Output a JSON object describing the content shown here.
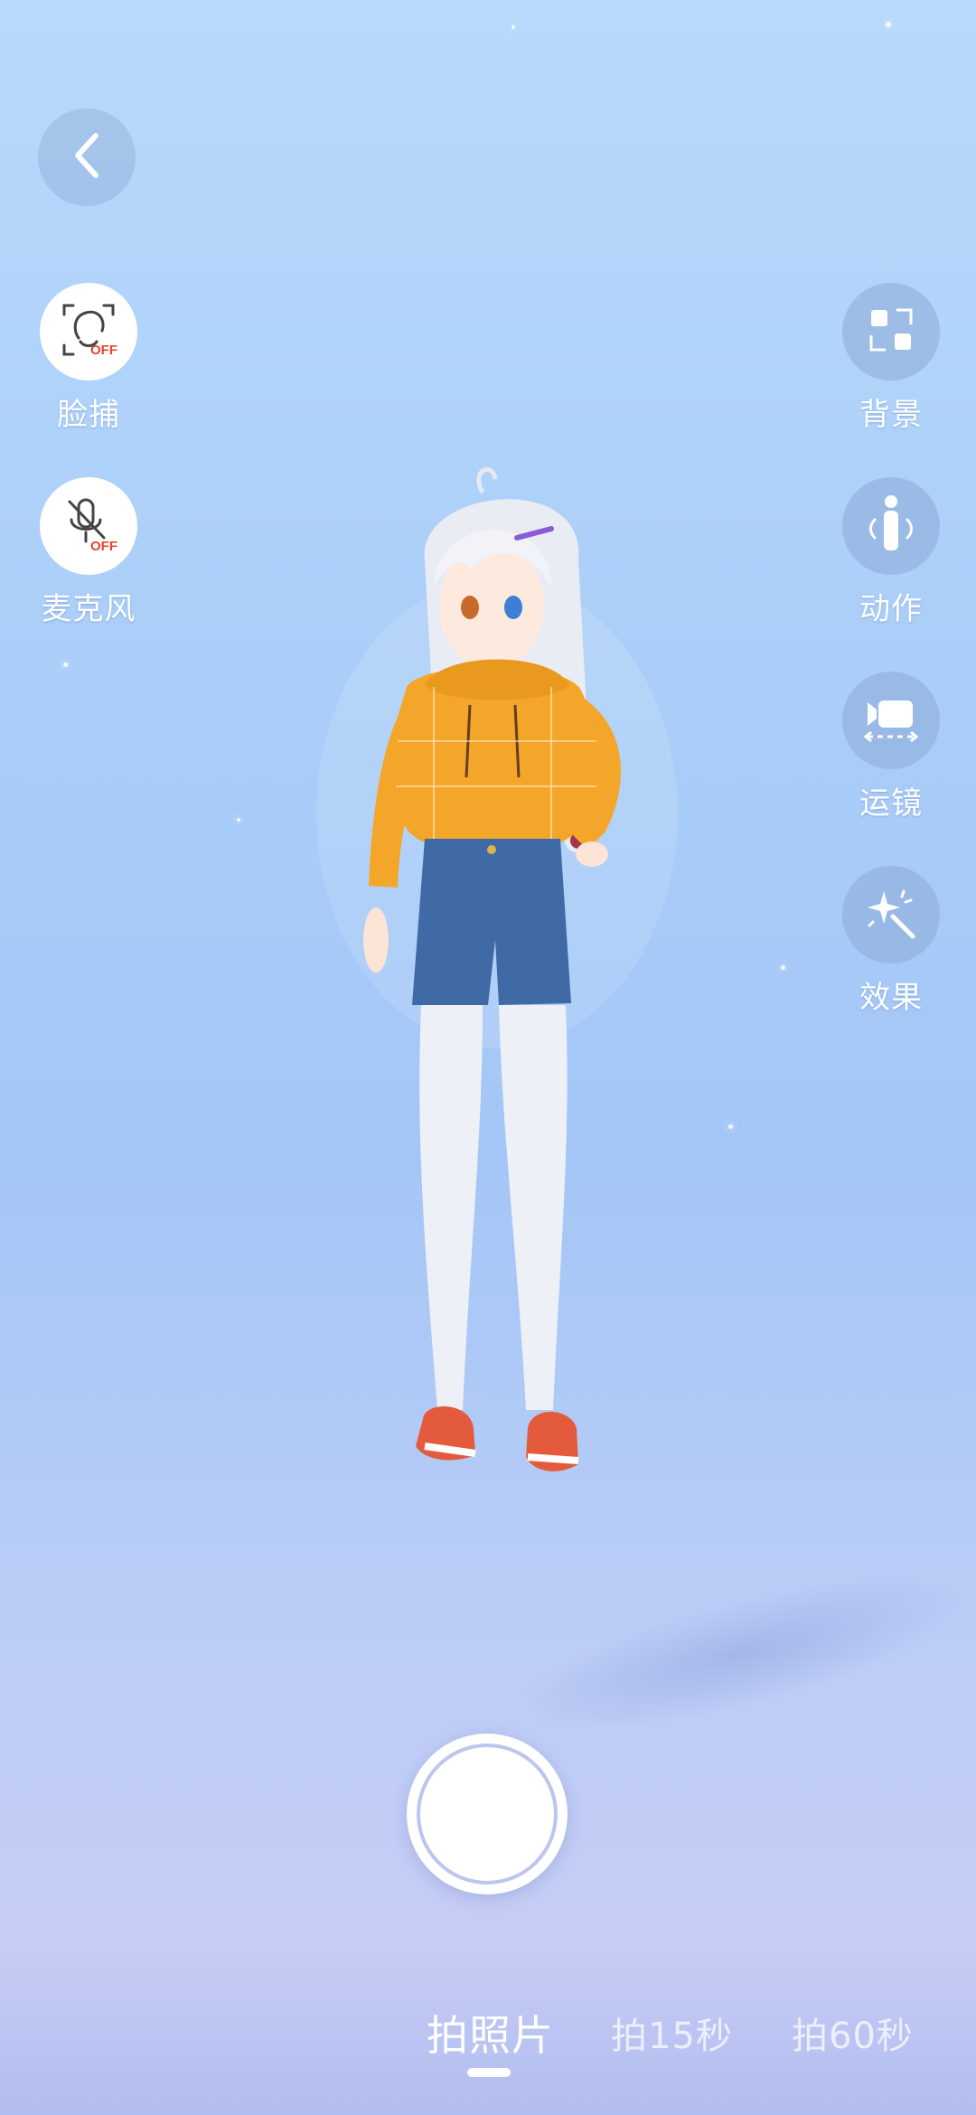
{
  "navigation": {
    "back_icon": "chevron-left-icon"
  },
  "left_controls": [
    {
      "id": "face-capture",
      "label": "脸捕",
      "icon": "face-scan-icon",
      "status": "OFF"
    },
    {
      "id": "microphone",
      "label": "麦克风",
      "icon": "microphone-off-icon",
      "status": "OFF"
    }
  ],
  "right_controls": [
    {
      "id": "background",
      "label": "背景",
      "icon": "background-grid-icon"
    },
    {
      "id": "motion",
      "label": "动作",
      "icon": "person-motion-icon"
    },
    {
      "id": "camera-move",
      "label": "运镜",
      "icon": "camera-move-icon"
    },
    {
      "id": "effects",
      "label": "效果",
      "icon": "magic-wand-icon"
    }
  ],
  "capture_modes": {
    "items": [
      "拍照片",
      "拍15秒",
      "拍60秒"
    ],
    "selected": "拍照片"
  },
  "colors": {
    "off_badge": "#e8442e",
    "hoodie": "#f4a62a",
    "shorts": "#3f6aa6"
  }
}
